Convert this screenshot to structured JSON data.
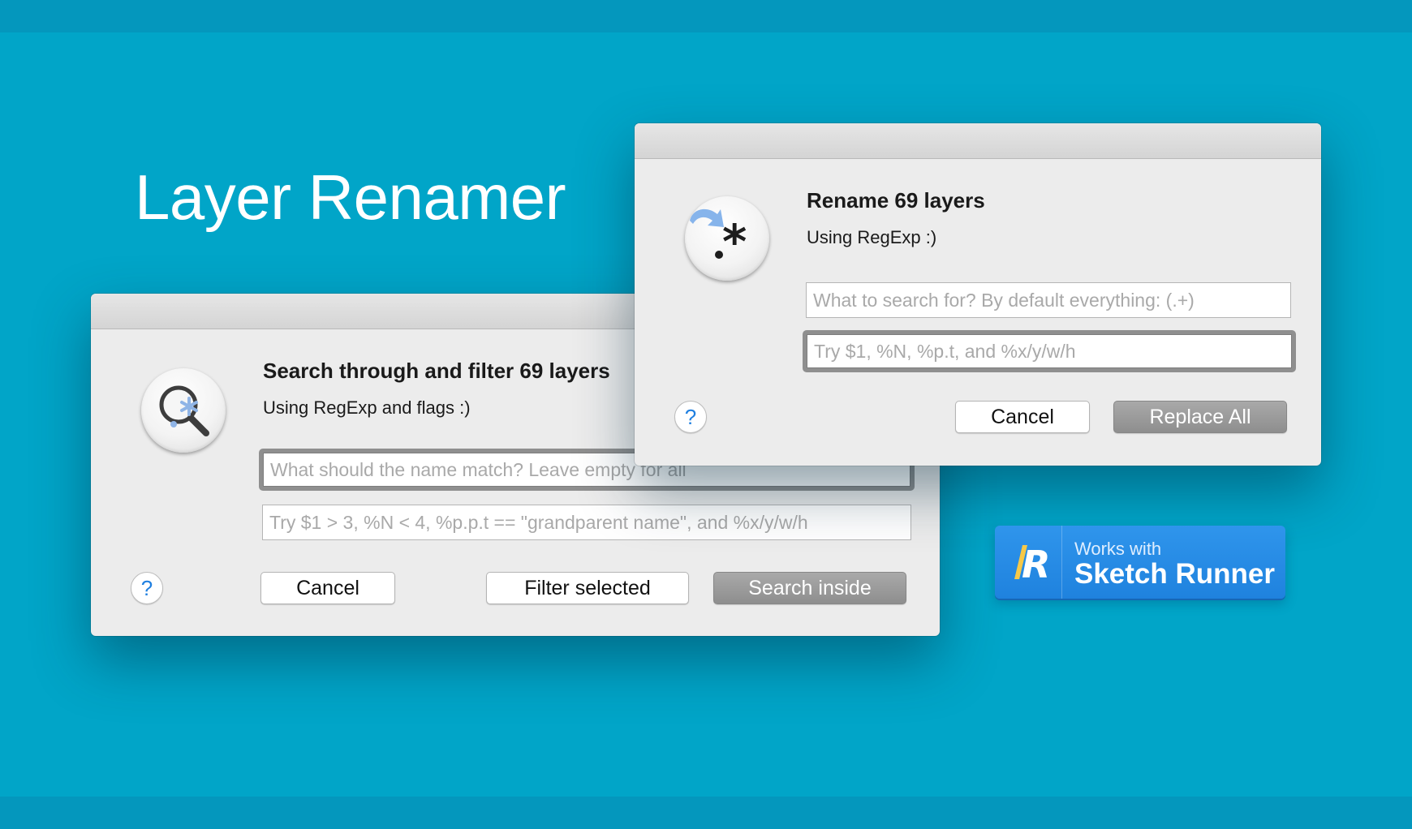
{
  "hero": {
    "title": "Layer Renamer"
  },
  "search_dialog": {
    "title": "Search through and filter 69 layers",
    "subtitle": "Using RegExp and flags :)",
    "match_field": {
      "placeholder": "What should the name match? Leave empty for all",
      "value": ""
    },
    "condition_field": {
      "placeholder": "Try $1 > 3, %N < 4, %p.p.t == \"grandparent name\", and %x/y/w/h",
      "value": ""
    },
    "help_label": "?",
    "cancel_label": "Cancel",
    "filter_label": "Filter selected",
    "search_label": "Search inside",
    "icon": "search-regexp-icon"
  },
  "rename_dialog": {
    "title": "Rename 69 layers",
    "subtitle": "Using RegExp :)",
    "search_field": {
      "placeholder": "What to search for? By default everything: (.+)",
      "value": ""
    },
    "replace_field": {
      "placeholder": "Try $1, %N, %p.t, and %x/y/w/h",
      "value": ""
    },
    "help_label": "?",
    "cancel_label": "Cancel",
    "replace_label": "Replace All",
    "icon": "rename-regexp-icon"
  },
  "badge": {
    "small_text": "Works with",
    "big_text": "Sketch Runner",
    "logo_letter": "R"
  },
  "colors": {
    "background": "#01a5c8",
    "band": "#0497bd",
    "help_accent": "#1f7fe0",
    "badge_blue": "#2a8fe8"
  }
}
